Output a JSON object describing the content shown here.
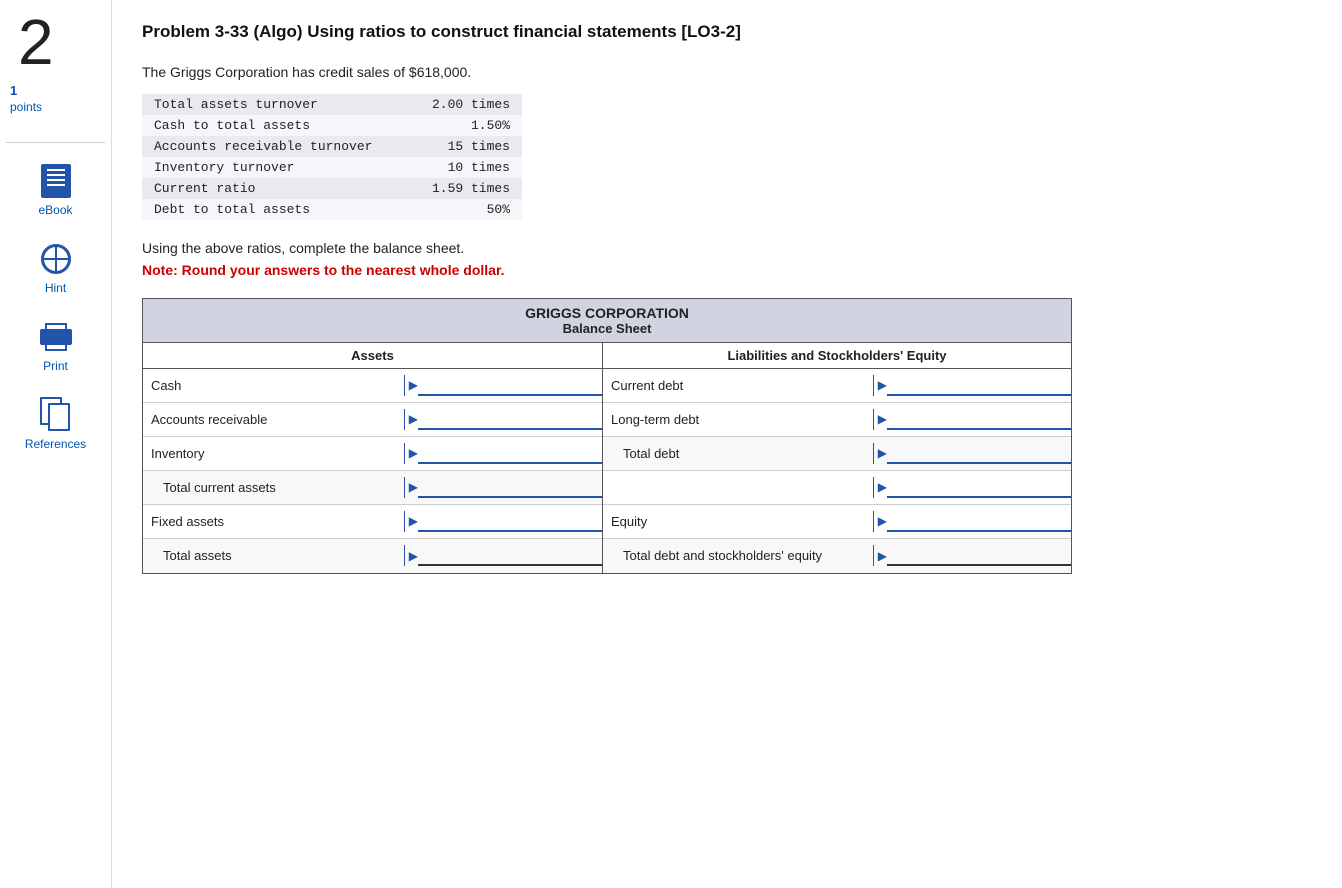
{
  "sidebar": {
    "problem_number": "2",
    "points_value": "1",
    "points_label": "points",
    "items": [
      {
        "id": "ebook",
        "label": "eBook",
        "icon": "book-icon"
      },
      {
        "id": "hint",
        "label": "Hint",
        "icon": "globe-icon"
      },
      {
        "id": "print",
        "label": "Print",
        "icon": "print-icon"
      },
      {
        "id": "references",
        "label": "References",
        "icon": "ref-icon"
      }
    ]
  },
  "problem": {
    "title": "Problem 3-33 (Algo) Using ratios to construct financial statements [LO3-2]",
    "intro": "The Griggs Corporation has credit sales of $618,000.",
    "ratios": [
      {
        "label": "Total assets turnover",
        "value": "2.00 times"
      },
      {
        "label": "Cash to total assets",
        "value": "1.50%"
      },
      {
        "label": "Accounts receivable turnover",
        "value": "15 times"
      },
      {
        "label": "Inventory turnover",
        "value": "10 times"
      },
      {
        "label": "Current ratio",
        "value": "1.59 times"
      },
      {
        "label": "Debt to total assets",
        "value": "50%"
      }
    ],
    "instruction": "Using the above ratios, complete the balance sheet.",
    "note": "Note: Round your answers to the nearest whole dollar."
  },
  "balance_sheet": {
    "company": "GRIGGS CORPORATION",
    "title": "Balance Sheet",
    "col_headers": {
      "assets": "Assets",
      "liabilities": "Liabilities and Stockholders' Equity"
    },
    "assets_rows": [
      {
        "label": "Cash",
        "indented": false
      },
      {
        "label": "Accounts receivable",
        "indented": false
      },
      {
        "label": "Inventory",
        "indented": false
      },
      {
        "label": "Total current assets",
        "indented": true
      },
      {
        "label": "Fixed assets",
        "indented": false
      },
      {
        "label": "Total assets",
        "indented": true
      }
    ],
    "liabilities_rows": [
      {
        "label": "Current debt",
        "indented": false
      },
      {
        "label": "Long-term debt",
        "indented": false
      },
      {
        "label": "Total debt",
        "indented": true
      },
      {
        "label": "",
        "indented": false
      },
      {
        "label": "Equity",
        "indented": false
      },
      {
        "label": "Total debt and stockholders' equity",
        "indented": true
      }
    ]
  }
}
